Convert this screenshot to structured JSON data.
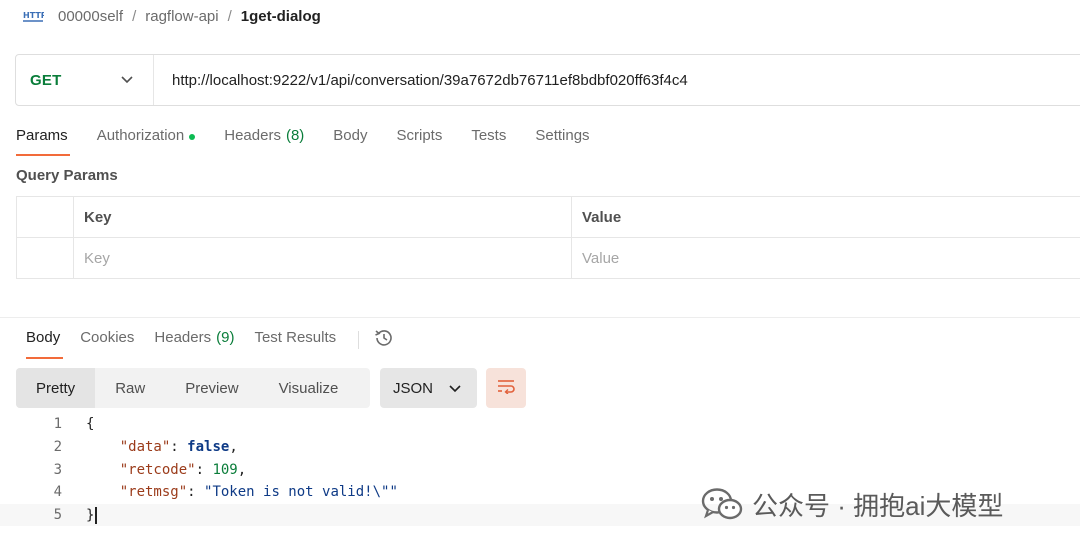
{
  "breadcrumb": {
    "icon": "http-icon",
    "icon_text": "HTTP",
    "items": [
      "00000self",
      "ragflow-api"
    ],
    "current": "1get-dialog",
    "separator": "/"
  },
  "request": {
    "method": "GET",
    "url": "http://localhost:9222/v1/api/conversation/39a7672db76711ef8bdbf020ff63f4c4"
  },
  "request_tabs": [
    {
      "label": "Params",
      "active": true
    },
    {
      "label": "Authorization",
      "indicator_dot": true
    },
    {
      "label": "Headers",
      "count": "(8)"
    },
    {
      "label": "Body"
    },
    {
      "label": "Scripts"
    },
    {
      "label": "Tests"
    },
    {
      "label": "Settings"
    }
  ],
  "query_params": {
    "title": "Query Params",
    "columns": [
      "Key",
      "Value"
    ],
    "placeholder_row": [
      "Key",
      "Value"
    ]
  },
  "response_tabs": [
    {
      "label": "Body",
      "active": true
    },
    {
      "label": "Cookies"
    },
    {
      "label": "Headers",
      "count": "(9)"
    },
    {
      "label": "Test Results"
    }
  ],
  "format_toolbar": {
    "modes": [
      "Pretty",
      "Raw",
      "Preview",
      "Visualize"
    ],
    "active_mode": "Pretty",
    "language": "JSON"
  },
  "response_body": {
    "line_numbers": [
      "1",
      "2",
      "3",
      "4",
      "5"
    ],
    "open_brace": "{",
    "close_brace": "}",
    "fields": [
      {
        "key": "\"data\"",
        "value": "false",
        "type": "boolean",
        "trail": ","
      },
      {
        "key": "\"retcode\"",
        "value": "109",
        "type": "number",
        "trail": ","
      },
      {
        "key": "\"retmsg\"",
        "value": "\"Token is not valid!\\\"\"",
        "type": "string",
        "trail": ""
      }
    ]
  },
  "watermark": {
    "text": "公众号 · 拥抱ai大模型"
  },
  "colors": {
    "accent": "#f26b3a",
    "method_get": "#0a7d3a",
    "status_dot": "#0cbb52"
  }
}
